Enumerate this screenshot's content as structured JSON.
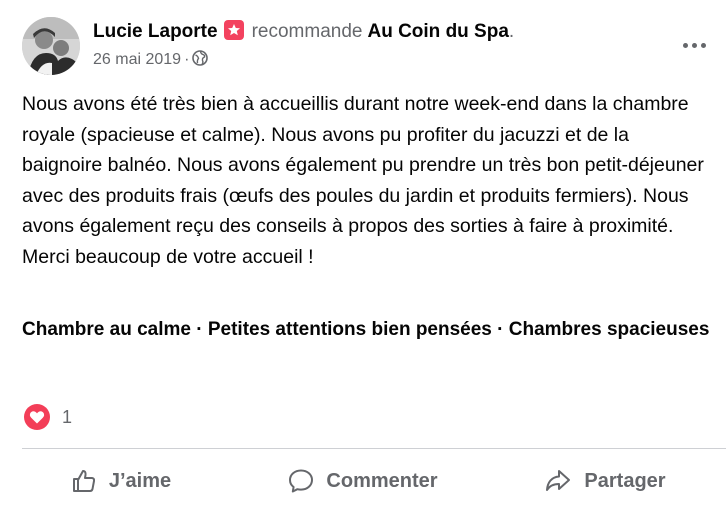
{
  "post": {
    "author": "Lucie Laporte",
    "recommend_icon": "star-badge-icon",
    "recommend_text": "recommande",
    "page_name": "Au Coin du Spa",
    "page_suffix": ".",
    "date": "26 mai 2019",
    "separator": "·",
    "privacy_icon": "globe-icon",
    "more_icon": "more-options-icon",
    "text": "Nous avons été très bien à accueillis durant notre week-end dans la chambre royale (spacieuse et calme). Nous avons pu profiter du jacuzzi et de la baignoire balnéo. Nous avons également pu prendre un très bon petit-déjeuner avec des produits frais (œufs des poules du jardin et produits fermiers). Nous avons également reçu des conseils à propos des sorties à faire à proximité. Merci beaucoup de votre accueil !",
    "tags": "Chambre au calme · Petites attentions bien pensées · Chambres spacieuses",
    "reaction_icon": "love-reaction-icon",
    "reaction_count": "1"
  },
  "actions": {
    "like": "J’aime",
    "comment": "Commenter",
    "share": "Partager"
  },
  "colors": {
    "text": "#050505",
    "secondary": "#65676b",
    "recommend_badge": "#f33e58",
    "divider": "#ced0d4"
  }
}
